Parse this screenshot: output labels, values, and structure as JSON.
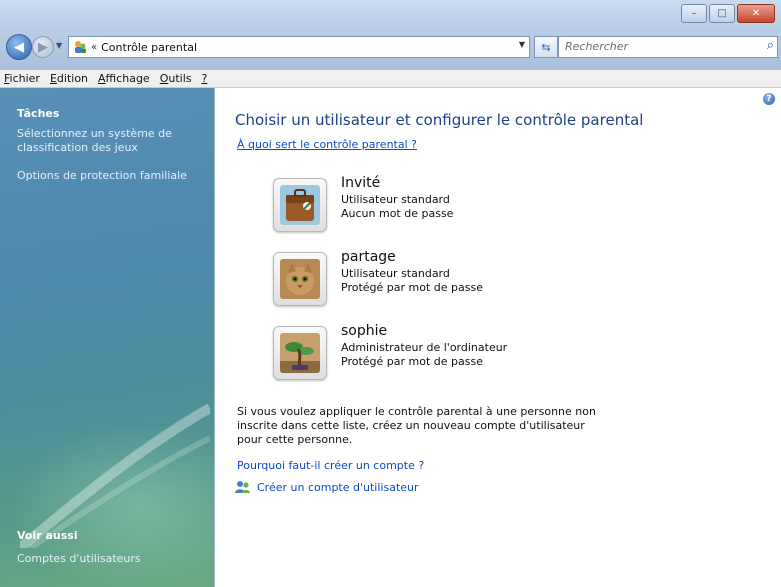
{
  "window": {
    "buttons": {
      "minimize": "–",
      "maximize": "□",
      "close": "✕"
    }
  },
  "nav": {
    "back_glyph": "◀",
    "forward_glyph": "▶",
    "address_chevron": "«",
    "address_text": "Contrôle parental",
    "address_dropdown": "▼",
    "refresh_glyph": "⇆",
    "search_placeholder": "Rechercher"
  },
  "menu": {
    "items": [
      {
        "u": "F",
        "rest": "ichier"
      },
      {
        "u": "E",
        "rest": "dition"
      },
      {
        "u": "A",
        "rest": "ffichage"
      },
      {
        "u": "O",
        "rest": "utils"
      },
      {
        "u": "?",
        "rest": ""
      }
    ]
  },
  "left": {
    "tasks_heading": "Tâches",
    "task1": "Sélectionnez un système de classification des jeux",
    "task2": "Options de protection familiale",
    "see_also_heading": "Voir aussi",
    "see_also_link": "Comptes d'utilisateurs"
  },
  "main": {
    "help": "?",
    "title": "Choisir un utilisateur et configurer le contrôle parental",
    "what_link": "À quoi sert le contrôle parental ?",
    "users": [
      {
        "name": "Invité",
        "type": "Utilisateur standard",
        "password": "Aucun mot de passe"
      },
      {
        "name": "partage",
        "type": "Utilisateur standard",
        "password": "Protégé par mot de passe"
      },
      {
        "name": "sophie",
        "type": "Administrateur de l'ordinateur",
        "password": "Protégé par mot de passe"
      }
    ],
    "info_text": "Si vous voulez appliquer le contrôle parental à une personne non inscrite dans cette liste, créez un nouveau compte d'utilisateur pour cette personne.",
    "why_link": "Pourquoi faut-il créer un compte ?",
    "create_link": "Créer un compte d'utilisateur"
  },
  "colors": {
    "title_blue": "#1e3f8a",
    "link_blue": "#0a4bc4",
    "pane_top": "#5a8fb7",
    "pane_bottom": "#6aa880"
  }
}
